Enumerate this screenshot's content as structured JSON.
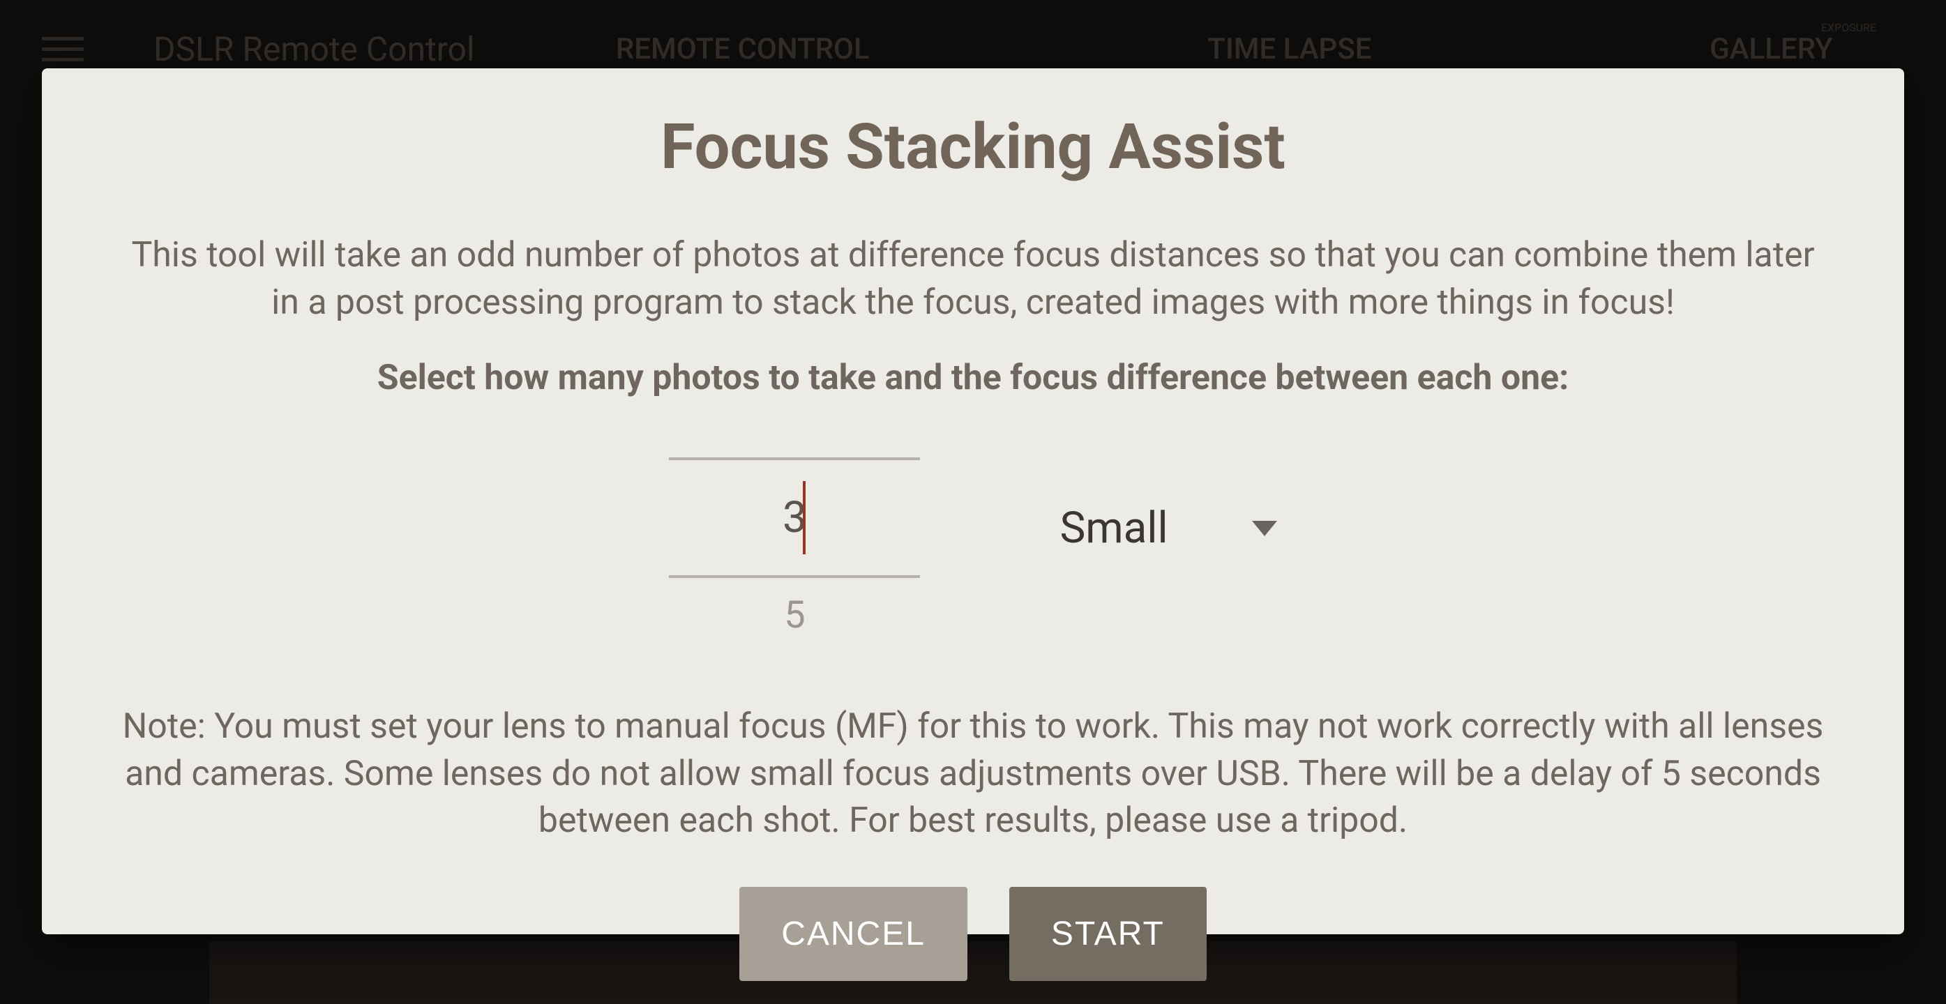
{
  "background": {
    "app_title": "DSLR Remote Control",
    "tabs": [
      "REMOTE CONTROL",
      "TIME LAPSE",
      "GALLERY",
      "EXPOSURE"
    ]
  },
  "dialog": {
    "title": "Focus Stacking Assist",
    "description": "This tool will take an odd number of photos at difference focus distances so that you can combine them later in a post processing program to stack the focus, created images with more things in focus!",
    "instruction": "Select how many photos to take and the focus difference between each one:",
    "picker": {
      "value": "3",
      "next": "5"
    },
    "select": {
      "value": "Small"
    },
    "note": "Note: You must set your lens to manual focus (MF) for this to work. This may not work correctly with all lenses and cameras. Some lenses do not allow small focus adjustments over USB. There will be a delay of 5 seconds between each shot. For best results, please use a tripod.",
    "buttons": {
      "cancel": "CANCEL",
      "start": "START"
    }
  }
}
